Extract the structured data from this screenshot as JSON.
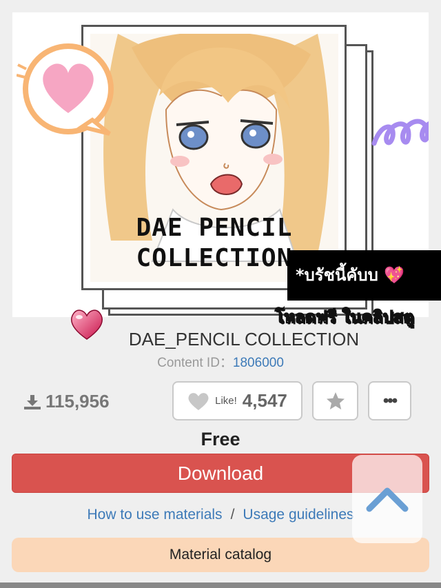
{
  "hero": {
    "cover_title_line1": "DAE PENCIL",
    "cover_title_line2": "COLLECTION",
    "sticker_black": "*บรัชนี้คับบ",
    "sticker_heart": "💖",
    "sticker_outline": "โหลดฟรี ในคลิปสตู"
  },
  "material": {
    "title": "DAE_PENCIL COLLECTION",
    "content_id_label": "Content ID：",
    "content_id_value": "1806000",
    "downloads": "115,956",
    "like_label": "Like!",
    "like_count": "4,547",
    "more_label": "•••",
    "price": "Free",
    "download_label": "Download",
    "link_how_to": "How to use materials",
    "link_separator": "/",
    "link_guidelines": "Usage guidelines",
    "catalog_label": "Material catalog"
  },
  "colors": {
    "download_button": "#d9534f",
    "link": "#3d7ab8",
    "catalog_bg": "#fbd7b8",
    "bubble_outline": "#f8b574",
    "bubble_heart": "#f6a6c3",
    "squiggle": "#a78bf0"
  },
  "icons": [
    "download-icon",
    "heart-icon",
    "star-icon",
    "more-icon",
    "chevron-up-icon",
    "speech-bubble-heart-sticker",
    "heart-emoji-icon"
  ]
}
